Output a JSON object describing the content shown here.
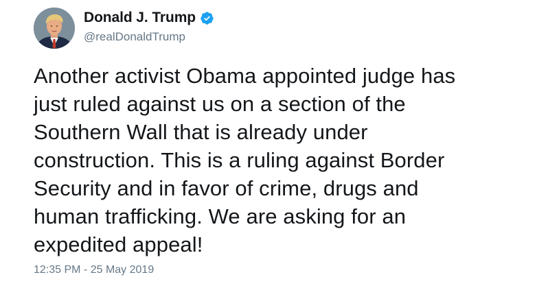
{
  "author": {
    "display_name": "Donald J. Trump",
    "handle": "@realDonaldTrump",
    "verified": true,
    "avatar_icon": "profile-photo"
  },
  "tweet": {
    "text": "Another activist Obama appointed judge has\njust ruled against us on a section of the\nSouthern Wall that is already under\nconstruction. This is a ruling against Border\nSecurity and in favor of crime, drugs and\nhuman trafficking. We are asking for an\nexpedited appeal!",
    "timestamp": "12:35 PM - 25 May 2019"
  },
  "colors": {
    "text": "#14171a",
    "secondary": "#657786",
    "verified_badge": "#1da1f2",
    "background": "#ffffff"
  }
}
